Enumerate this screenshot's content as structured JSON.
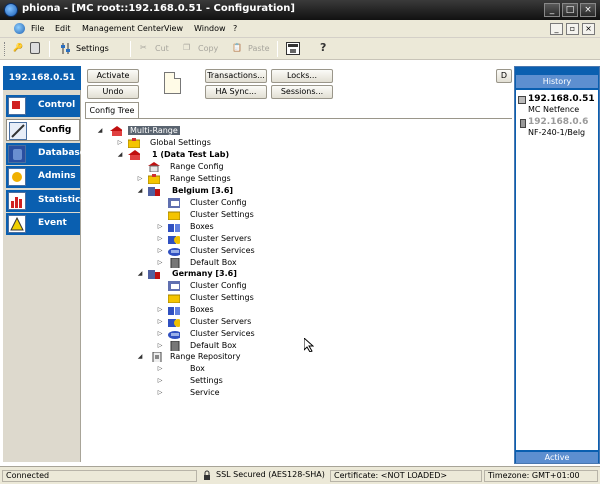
{
  "window": {
    "title": "phiona - [MC root::192.168.0.51 - Configuration]"
  },
  "menu": [
    "File",
    "Edit",
    "Management Center",
    "View",
    "Window",
    "?"
  ],
  "toolbar": {
    "settings": "Settings",
    "cut": "Cut",
    "copy": "Copy",
    "paste": "Paste"
  },
  "nav": {
    "ip": "192.168.0.51",
    "items": [
      {
        "label": "Control",
        "icon": "control-icon"
      },
      {
        "label": "Config",
        "icon": "config-icon"
      },
      {
        "label": "Database",
        "icon": "database-icon"
      },
      {
        "label": "Admins",
        "icon": "admins-icon"
      },
      {
        "label": "Statistics",
        "icon": "statistics-icon"
      },
      {
        "label": "Event",
        "icon": "event-icon"
      }
    ]
  },
  "buttons": {
    "activate": "Activate",
    "undo": "Undo",
    "transactions": "Transactions...",
    "ha_sync": "HA Sync...",
    "locks": "Locks...",
    "sessions": "Sessions...",
    "d": "D"
  },
  "tab": "Config Tree",
  "tree": {
    "root": "Multi-Range",
    "global_settings": "Global Settings",
    "range": "1 (Data Test Lab)",
    "range_config": "Range Config",
    "range_settings": "Range Settings",
    "clusters": [
      {
        "name": "Belgium [3.6]",
        "items": [
          "Cluster Config",
          "Cluster Settings",
          "Boxes",
          "Cluster Servers",
          "Cluster Services",
          "Default Box"
        ]
      },
      {
        "name": "Germany [3.6]",
        "items": [
          "Cluster Config",
          "Cluster Settings",
          "Boxes",
          "Cluster Servers",
          "Cluster Services",
          "Default Box"
        ]
      }
    ],
    "repository": "Range Repository",
    "repo_items": [
      "Box",
      "Settings",
      "Service"
    ]
  },
  "history": {
    "header": "History",
    "entries": [
      {
        "title": "192.168.0.51",
        "sub": "MC Netfence"
      },
      {
        "title": "192.168.0.6",
        "sub": "NF-240-1/Belg"
      }
    ],
    "footer": "Active"
  },
  "status": {
    "connected": "Connected",
    "ssl": "SSL Secured (AES128-SHA)",
    "cert": "Certificate: <NOT LOADED>",
    "tz": "Timezone: GMT+01:00"
  },
  "colors": {
    "nav_blue": "#0a5fb0",
    "panel_bg": "#ece9d8",
    "highlight": "#5a6470"
  }
}
